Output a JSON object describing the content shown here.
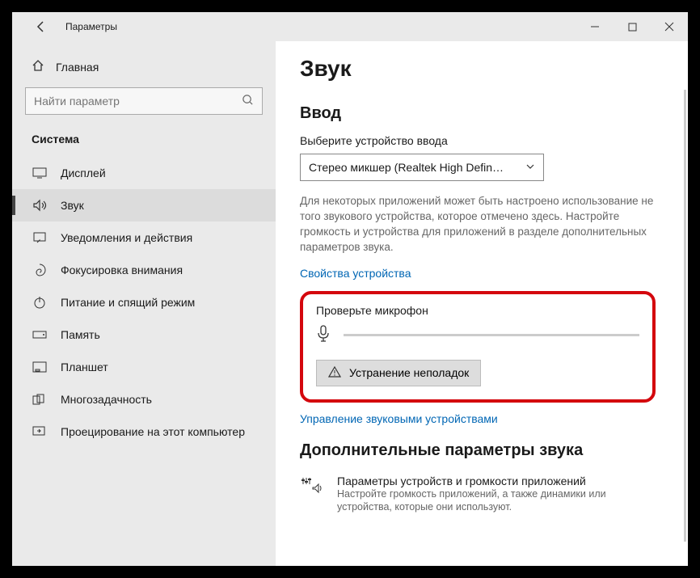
{
  "window": {
    "title": "Параметры"
  },
  "sidebar": {
    "home": "Главная",
    "search_placeholder": "Найти параметр",
    "category": "Система",
    "items": [
      {
        "label": "Дисплей",
        "icon": "display"
      },
      {
        "label": "Звук",
        "icon": "sound",
        "active": true
      },
      {
        "label": "Уведомления и действия",
        "icon": "notifications"
      },
      {
        "label": "Фокусировка внимания",
        "icon": "focus"
      },
      {
        "label": "Питание и спящий режим",
        "icon": "power"
      },
      {
        "label": "Память",
        "icon": "storage"
      },
      {
        "label": "Планшет",
        "icon": "tablet"
      },
      {
        "label": "Многозадачность",
        "icon": "multitask"
      },
      {
        "label": "Проецирование на этот компьютер",
        "icon": "project"
      }
    ]
  },
  "content": {
    "page_title": "Звук",
    "input_section": "Ввод",
    "choose_device_label": "Выберите устройство ввода",
    "device_selected": "Стерео микшер (Realtek High Defin…",
    "helper": "Для некоторых приложений может быть настроено использование не того звукового устройства, которое отмечено здесь. Настройте громкость и устройства для приложений в разделе дополнительных параметров звука.",
    "device_props_link": "Свойства устройства",
    "test_mic_label": "Проверьте микрофон",
    "troubleshoot_btn": "Устранение неполадок",
    "manage_devices_link": "Управление звуковыми устройствами",
    "advanced_title": "Дополнительные параметры звука",
    "advanced_item_title": "Параметры устройств и громкости приложений",
    "advanced_item_desc": "Настройте громкость приложений, а также динамики или устройства, которые они используют."
  }
}
